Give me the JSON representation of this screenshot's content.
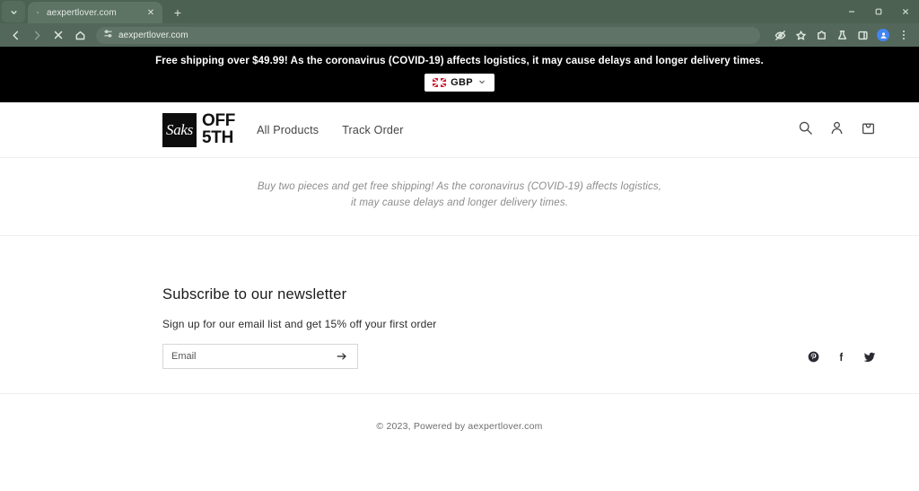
{
  "browser": {
    "tab": {
      "title": "aexpertlover.com",
      "favicon_icon": "page-favicon",
      "close_icon": "close-icon"
    },
    "tab_list_icon": "chevron-down-icon",
    "new_tab_icon": "plus-icon",
    "window_controls": {
      "minimize": "minimize-icon",
      "maximize": "maximize-icon",
      "close": "close-icon"
    },
    "nav": {
      "back_icon": "arrow-left-icon",
      "forward_icon": "arrow-right-icon",
      "stop_icon": "stop-x-icon",
      "home_icon": "home-icon"
    },
    "omnibox": {
      "site_settings_icon": "tune-icon",
      "url": "aexpertlover.com"
    },
    "actions": {
      "tracking_protection_icon": "eye-slash-icon",
      "bookmark_icon": "star-icon",
      "extensions_icon": "extensions-puzzle-icon",
      "experiments_icon": "flask-icon",
      "side_panel_icon": "side-panel-icon",
      "profile_icon": "profile-avatar-icon",
      "menu_icon": "three-dots-menu-icon"
    }
  },
  "announcement_bar": {
    "text": "Free shipping over $49.99! As the coronavirus (COVID-19) affects logistics, it may cause delays and longer delivery times.",
    "currency": {
      "flag_icon": "uk-flag-icon",
      "label": "GBP",
      "caret_icon": "chevron-down-icon"
    },
    "background": "#000000",
    "text_color": "#ffffff"
  },
  "site_header": {
    "logo": {
      "mark_text": "Saks",
      "line1": "OFF",
      "line2": "5TH"
    },
    "nav_links": [
      {
        "label": "All Products"
      },
      {
        "label": "Track Order"
      }
    ],
    "icons": [
      {
        "name": "search-icon"
      },
      {
        "name": "account-icon"
      },
      {
        "name": "cart-bag-icon"
      }
    ]
  },
  "announcement_band": {
    "line1": "Buy two pieces and get free shipping! As the coronavirus (COVID-19) affects logistics,",
    "line2": "it may cause delays and longer delivery times."
  },
  "newsletter": {
    "title": "Subscribe to our newsletter",
    "subtitle": "Sign up for our email list and get 15% off your first order",
    "email_placeholder": "Email",
    "email_value": "",
    "submit_icon": "arrow-right-icon",
    "socials": [
      {
        "name": "pinterest-icon"
      },
      {
        "name": "facebook-icon"
      },
      {
        "name": "twitter-icon"
      }
    ]
  },
  "footer": {
    "copyright": "© 2023, Powered by aexpertlover.com"
  }
}
